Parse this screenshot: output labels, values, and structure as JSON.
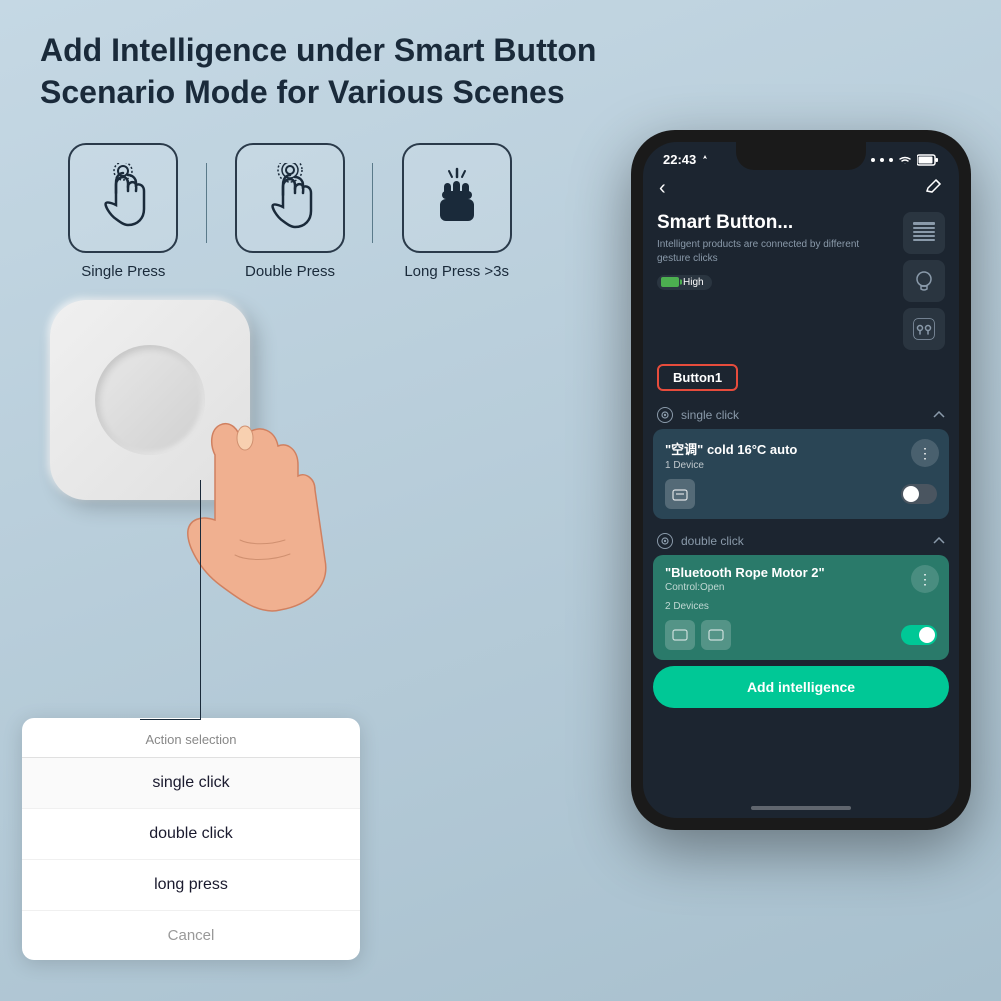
{
  "page": {
    "background_color": "#b8cdd9",
    "title": "Add Intelligence under Smart Button Scenario Mode for Various Scenes"
  },
  "press_types": [
    {
      "id": "single-press",
      "label": "Single Press",
      "icon": "single-press-icon"
    },
    {
      "id": "double-press",
      "label": "Double Press",
      "icon": "double-press-icon"
    },
    {
      "id": "long-press",
      "label": "Long Press >3s",
      "icon": "long-press-icon"
    }
  ],
  "action_popup": {
    "title": "Action selection",
    "items": [
      {
        "label": "single click",
        "selected": true
      },
      {
        "label": "double click",
        "selected": false
      },
      {
        "label": "long press",
        "selected": false
      }
    ],
    "cancel_label": "Cancel"
  },
  "phone": {
    "status_bar": {
      "time": "22:43",
      "signal_icon": "signal-icon",
      "wifi_icon": "wifi-icon",
      "battery_icon": "battery-icon"
    },
    "nav": {
      "back_icon": "back-arrow-icon",
      "edit_icon": "edit-pencil-icon"
    },
    "device": {
      "name": "Smart Button...",
      "subtitle": "Intelligent products are connected by different gesture clicks",
      "battery_level": "High"
    },
    "button_tab": "Button1",
    "sections": [
      {
        "id": "single-click",
        "label": "single click",
        "expand_icon": "expand-icon",
        "card": {
          "title": "\"空调\" cold 16°C auto",
          "device_count": "1 Device",
          "toggle_on": false,
          "more_icon": "more-dots-icon"
        }
      },
      {
        "id": "double-click",
        "label": "double click",
        "expand_icon": "expand-icon",
        "card": {
          "title": "\"Bluetooth Rope Motor 2\"",
          "subtitle": "Control:Open",
          "device_count": "2 Devices",
          "toggle_on": true,
          "more_icon": "more-dots-icon"
        }
      }
    ],
    "add_intelligence_label": "Add intelligence"
  }
}
